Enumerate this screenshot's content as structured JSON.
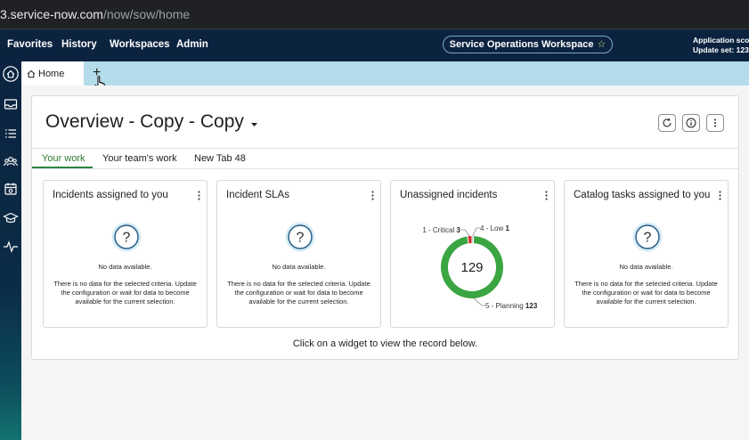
{
  "browser": {
    "url_host": "3.service-now.com",
    "url_path": "/now/sow/home"
  },
  "topnav": {
    "items": [
      "Favorites",
      "History",
      "Workspaces",
      "Admin"
    ],
    "workspace_pill": "Service Operations Workspace",
    "scope_line1": "Application scop",
    "scope_line2": "Update set: 123"
  },
  "sidebar": {
    "icons": [
      "home-icon",
      "inbox-icon",
      "list-icon",
      "team-icon",
      "calendar-icon",
      "learning-icon",
      "pulse-icon"
    ]
  },
  "tabbar": {
    "home_label": "Home",
    "add_tab_symbol": "+"
  },
  "page": {
    "title": "Overview - Copy - Copy"
  },
  "subtabs": [
    "Your work",
    "Your team's work",
    "New Tab 48"
  ],
  "widgets": [
    {
      "title": "Incidents assigned to you",
      "nodata": "No data available.",
      "desc": "There is no data for the selected criteria. Update the configuration or wait for data to become available for the current selection."
    },
    {
      "title": "Incident SLAs",
      "nodata": "No data available.",
      "desc": "There is no data for the selected criteria. Update the configuration or wait for data to become available for the current selection."
    },
    {
      "title": "Unassigned incidents"
    },
    {
      "title": "Catalog tasks assigned to you",
      "nodata": "No data available.",
      "desc": "There is no data for the selected criteria. Update the configuration or wait for data to become available for the current selection."
    }
  ],
  "chart_data": {
    "type": "pie",
    "title": "Unassigned incidents",
    "center_label": "129",
    "slices": [
      {
        "label": "1 - Critical",
        "value": 3,
        "color": "#d32f2f"
      },
      {
        "label": "4 - Low",
        "value": 1,
        "color": "#9e9e9e"
      },
      {
        "label": "5 - Planning",
        "value": 123,
        "color": "#3aa541"
      }
    ],
    "legend": "callouts"
  },
  "footer": {
    "hint": "Click on a widget to view the record below."
  },
  "colors": {
    "nav_bg": "#0c2340",
    "tab_bar_bg": "#b4dcea",
    "active_tab": "#2e8540"
  }
}
